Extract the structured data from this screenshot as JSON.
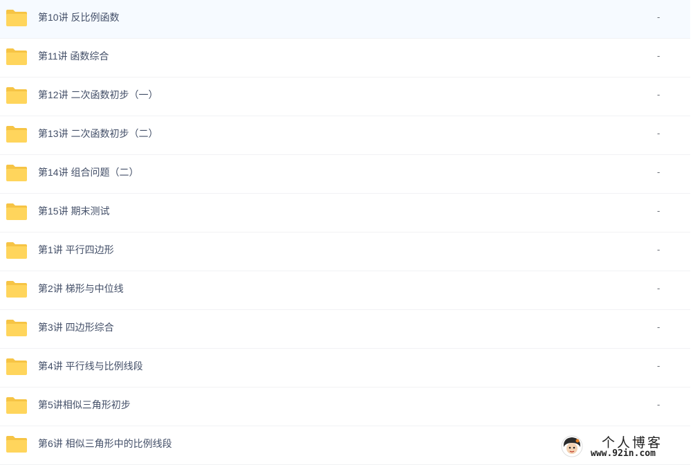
{
  "file_list": {
    "items": [
      {
        "name": "第10讲 反比例函数",
        "size": "-",
        "icon": "folder-icon"
      },
      {
        "name": "第11讲 函数综合",
        "size": "-",
        "icon": "folder-icon"
      },
      {
        "name": "第12讲 二次函数初步（一）",
        "size": "-",
        "icon": "folder-icon"
      },
      {
        "name": "第13讲 二次函数初步（二）",
        "size": "-",
        "icon": "folder-icon"
      },
      {
        "name": "第14讲 组合问题（二）",
        "size": "-",
        "icon": "folder-icon"
      },
      {
        "name": "第15讲 期末测试",
        "size": "-",
        "icon": "folder-icon"
      },
      {
        "name": "第1讲 平行四边形",
        "size": "-",
        "icon": "folder-icon"
      },
      {
        "name": "第2讲 梯形与中位线",
        "size": "-",
        "icon": "folder-icon"
      },
      {
        "name": "第3讲 四边形综合",
        "size": "-",
        "icon": "folder-icon"
      },
      {
        "name": "第4讲 平行线与比例线段",
        "size": "-",
        "icon": "folder-icon"
      },
      {
        "name": "第5讲相似三角形初步",
        "size": "-",
        "icon": "folder-icon"
      },
      {
        "name": "第6讲 相似三角形中的比例线段",
        "size": "",
        "icon": "folder-icon"
      }
    ]
  },
  "watermark": {
    "title": "个人博客",
    "url": "www.92in.com",
    "icon": "avatar-logo"
  },
  "colors": {
    "folder_body": "#ffd55c",
    "folder_tab": "#f6c445",
    "text": "#424e67",
    "row_divider": "#f1f2f4"
  }
}
